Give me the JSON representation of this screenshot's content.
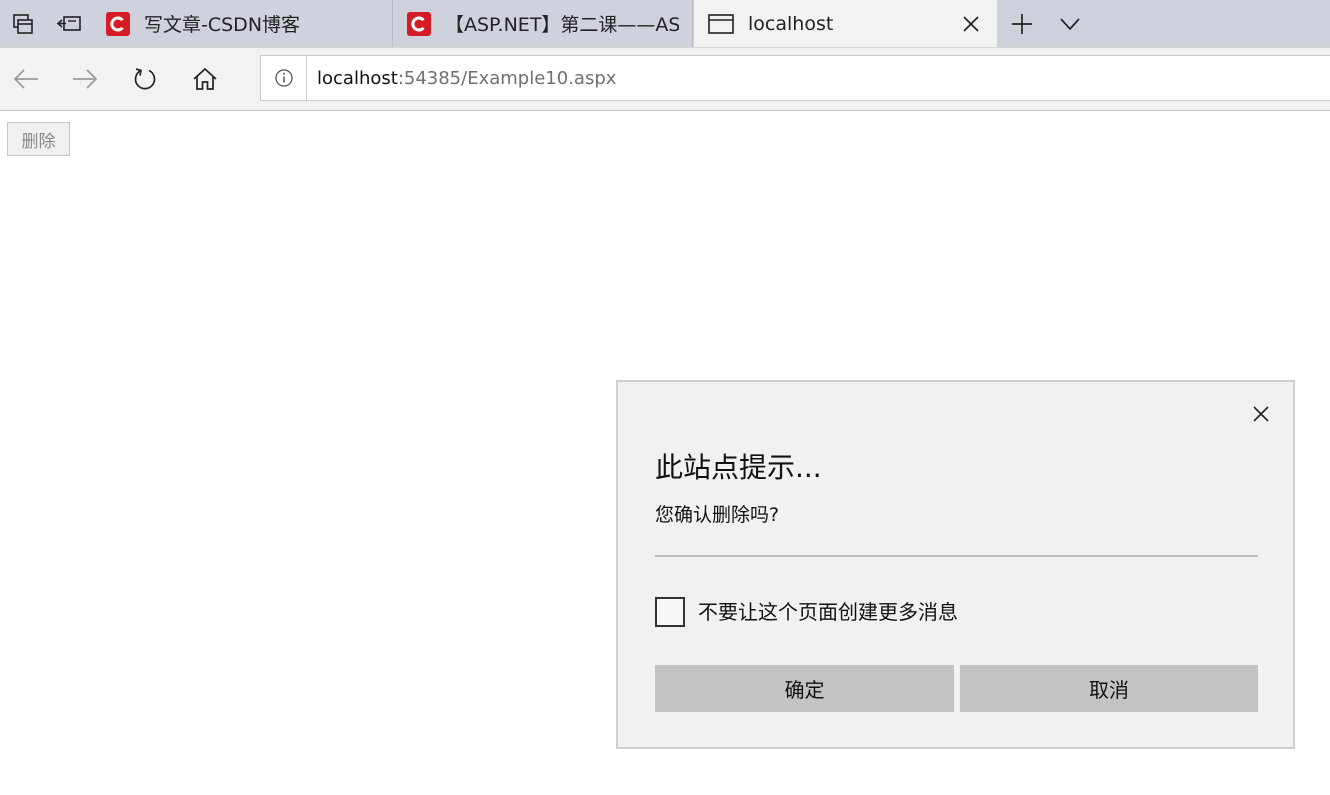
{
  "browser": {
    "tabs": [
      {
        "title": "写文章-CSDN博客",
        "favicon": "csdn-logo-icon"
      },
      {
        "title": "【ASP.NET】第二课——ASP",
        "favicon": "csdn-logo-icon"
      },
      {
        "title": "localhost",
        "favicon": "page-icon",
        "active": true
      }
    ],
    "address": {
      "host": "localhost",
      "path": ":54385/Example10.aspx"
    }
  },
  "page": {
    "delete_button": "删除"
  },
  "dialog": {
    "title": "此站点提示...",
    "message": "您确认删除吗?",
    "checkbox_label": "不要让这个页面创建更多消息",
    "checkbox_checked": false,
    "ok_label": "确定",
    "cancel_label": "取消"
  },
  "colors": {
    "tabstrip": "#cfd2dd",
    "csdn_red": "#d51c24",
    "dialog_bg": "#f1f1f1",
    "dialog_button": "#c3c3c3"
  }
}
